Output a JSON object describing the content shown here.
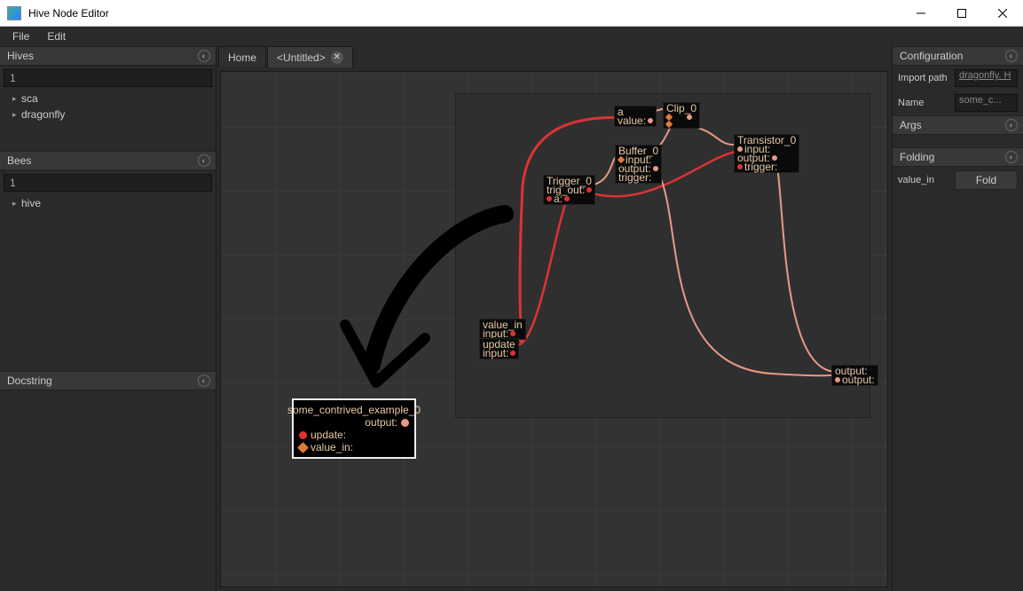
{
  "window": {
    "title": "Hive Node Editor"
  },
  "menu": {
    "file": "File",
    "edit": "Edit"
  },
  "panels": {
    "hives": {
      "title": "Hives",
      "search": "1",
      "items": [
        "sca",
        "dragonfly"
      ]
    },
    "bees": {
      "title": "Bees",
      "search": "1",
      "items": [
        "hive"
      ]
    },
    "docstring": {
      "title": "Docstring"
    }
  },
  "tabs": {
    "home": "Home",
    "untitled": "<Untitled>"
  },
  "config": {
    "title": "Configuration",
    "import_path_label": "Import path",
    "import_path_value": "dragonfly.  H",
    "name_label": "Name",
    "name_value": "some_c..."
  },
  "args": {
    "title": "Args"
  },
  "folding": {
    "title": "Folding",
    "param": "value_in",
    "button": "Fold"
  },
  "bignode": {
    "title": "some_contrived_example_0",
    "output": "output:",
    "update": "update:",
    "value_in": "value_in:"
  },
  "minis": {
    "a": "a",
    "a_sub": "value:",
    "clip": "Clip_0",
    "buffer": "Buffer_0",
    "buffer_rows": [
      "input:",
      "output:",
      "trigger:"
    ],
    "trigger": "Trigger_0",
    "trigger_rows": [
      "trig_out:",
      "a:"
    ],
    "value_in": "value_in",
    "value_in_row": "input:",
    "update": "update",
    "update_row": "input:",
    "transistor": "Transistor_0",
    "transistor_rows": [
      "input:",
      "output:",
      "trigger:"
    ],
    "output": "output:",
    "output_row": "output:"
  }
}
